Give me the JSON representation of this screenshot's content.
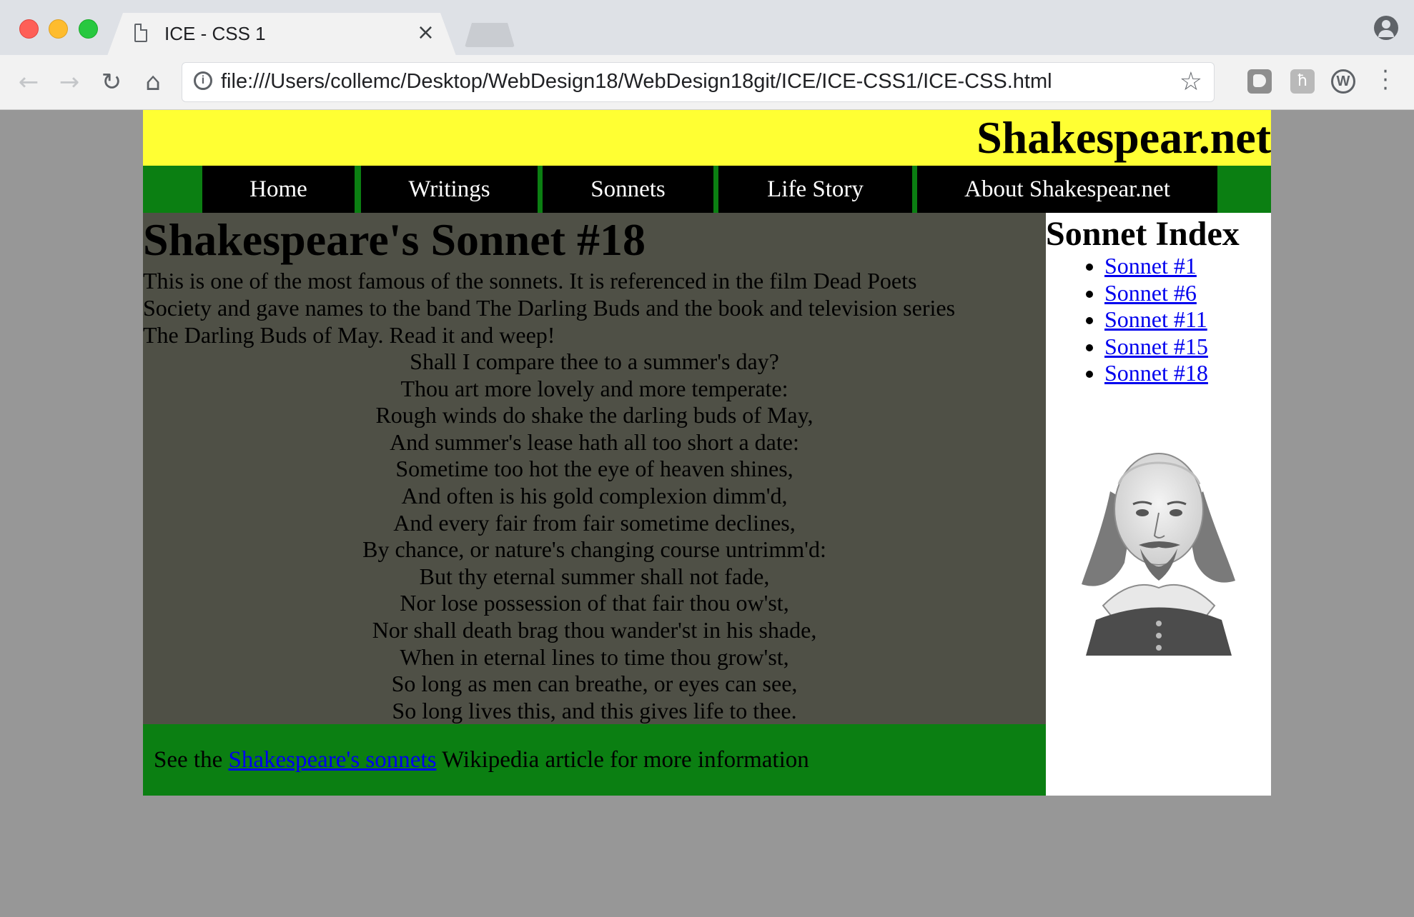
{
  "browser": {
    "tab_title": "ICE - CSS 1",
    "tab_close": "×",
    "url": "file:///Users/collemc/Desktop/WebDesign18/WebDesign18git/ICE/ICE-CSS1/ICE-CSS.html",
    "icons": {
      "back": "back-arrow-icon",
      "forward": "forward-arrow-icon",
      "reload": "reload-icon",
      "home": "home-icon",
      "info": "info-icon",
      "bookmark": "star-icon",
      "menu": "menu-dots-icon"
    }
  },
  "site": {
    "title": "Shakespear.net",
    "nav": [
      "Home",
      "Writings",
      "Sonnets",
      "Life Story",
      "About Shakespear.net"
    ],
    "colors": {
      "header_bg": "#ffff33",
      "nav_bg": "#0b7f12",
      "main_bg": "#4f5046",
      "footer_bg": "#0b7f12"
    }
  },
  "main": {
    "heading": "Shakespeare's Sonnet #18",
    "intro": "This is one of the most famous of the sonnets. It is referenced in the film Dead Poets Society and gave names to the band The Darling Buds and the book and television series The Darling Buds of May. Read it and weep!",
    "poem": [
      "Shall I compare thee to a summer's day?",
      "Thou art more lovely and more temperate:",
      "Rough winds do shake the darling buds of May,",
      "And summer's lease hath all too short a date:",
      "Sometime too hot the eye of heaven shines,",
      "And often is his gold complexion dimm'd,",
      "And every fair from fair sometime declines,",
      "By chance, or nature's changing course untrimm'd:",
      "But thy eternal summer shall not fade,",
      "Nor lose possession of that fair thou ow'st,",
      "Nor shall death brag thou wander'st in his shade,",
      "When in eternal lines to time thou grow'st,",
      "So long as men can breathe, or eyes can see,",
      "So long lives this, and this gives life to thee."
    ]
  },
  "footer": {
    "prefix": "See the",
    "link": "Shakespeare's sonnets",
    "suffix": "Wikipedia article for more information"
  },
  "sidebar": {
    "heading": "Sonnet Index",
    "links": [
      "Sonnet #1",
      "Sonnet #6",
      "Sonnet #11",
      "Sonnet #15",
      "Sonnet #18"
    ],
    "image": "shakespeare-portrait"
  }
}
